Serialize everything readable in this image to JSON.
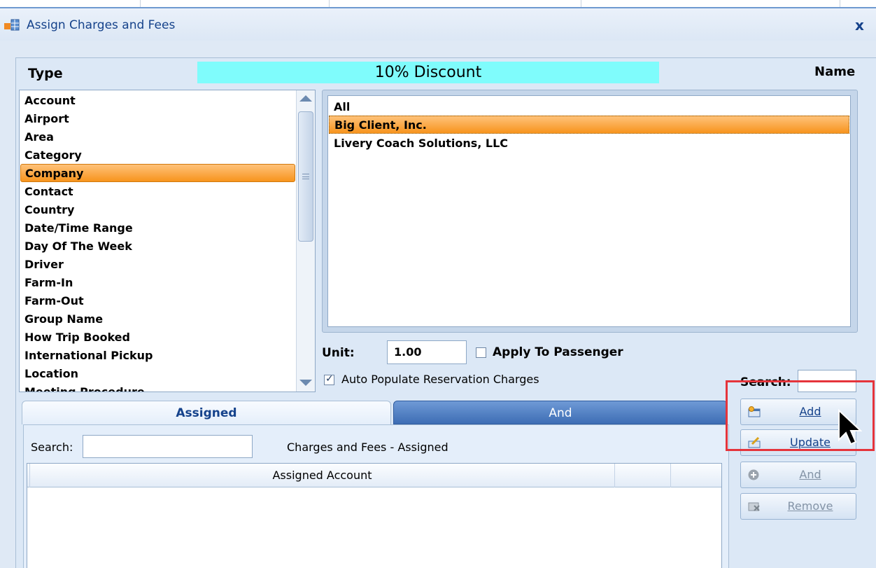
{
  "window": {
    "title": "Assign Charges and Fees",
    "close_glyph": "x",
    "icon": "grid-window-icon"
  },
  "header": {
    "type_label": "Type",
    "name_label": "Name",
    "selected_charge": "10% Discount",
    "selected_charge_bg": "#7ffcfc"
  },
  "type_list": {
    "selected_index": 4,
    "items": [
      "Account",
      "Airport",
      "Area",
      "Category",
      "Company",
      "Contact",
      "Country",
      "Date/Time Range",
      "Day Of The Week",
      "Driver",
      "Farm-In",
      "Farm-Out",
      "Group Name",
      "How Trip Booked",
      "International Pickup",
      "Location",
      "Meeting Procedure"
    ]
  },
  "name_list": {
    "selected_index": 1,
    "items": [
      "All",
      "Big Client, Inc.",
      "Livery Coach Solutions, LLC"
    ]
  },
  "unit": {
    "label": "Unit:",
    "value": "1.00"
  },
  "apply_to_passenger": {
    "label": "Apply To Passenger",
    "checked": false
  },
  "auto_populate": {
    "label": "Auto Populate Reservation Charges",
    "checked": true
  },
  "right_search": {
    "label": "Search:",
    "value": ""
  },
  "tabs": [
    {
      "label": "Assigned",
      "active": true
    },
    {
      "label": "And",
      "active": false
    }
  ],
  "assigned": {
    "search_label": "Search:",
    "search_value": "",
    "caption": "Charges and Fees - Assigned",
    "columns": [
      "Assigned Account",
      "",
      ""
    ]
  },
  "buttons": {
    "add": {
      "label": "Add",
      "icon": "add-icon"
    },
    "update": {
      "label": "Update",
      "icon": "edit-icon"
    },
    "and": {
      "label": "And",
      "icon": "plus-circle-icon"
    },
    "remove": {
      "label": "Remove",
      "icon": "remove-icon"
    }
  },
  "colors": {
    "selection": "#f7941d",
    "highlight": "#e5343b",
    "accent": "#15428b"
  }
}
